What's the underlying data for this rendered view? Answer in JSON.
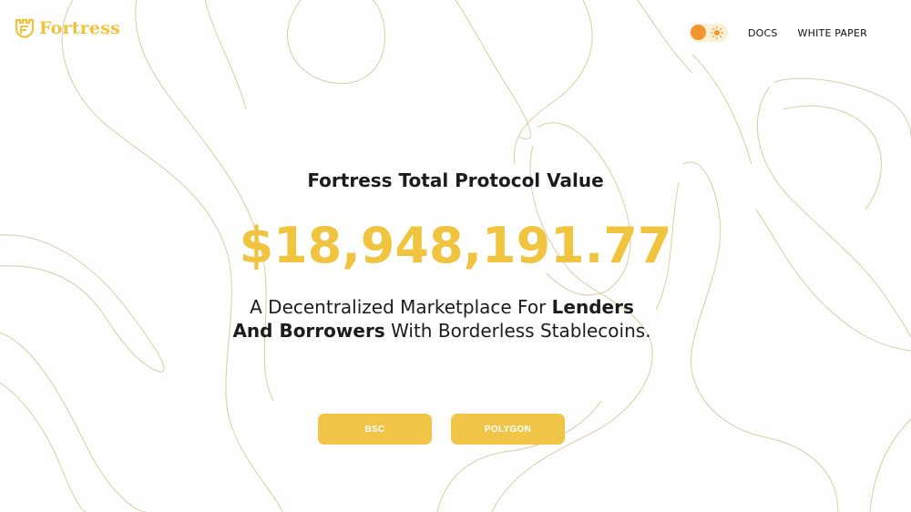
{
  "header": {
    "logo_text": "Fortress",
    "nav": {
      "theme_toggle": {
        "state": "light"
      },
      "docs_label": "DOCS",
      "whitepaper_label": "WHITE PAPER"
    }
  },
  "hero": {
    "title": "Fortress Total Protocol Value",
    "value": "$18,948,191.77",
    "tagline": {
      "part1": "A Decentralized Marketplace For ",
      "bold": "Lenders And Borrowers",
      "part2": " With Borderless Stablecoins."
    }
  },
  "actions": {
    "bsc_label": "BSC",
    "polygon_label": "POLYGON"
  },
  "colors": {
    "accent": "#f0c43f",
    "toggle_knob": "#f2952e",
    "contour": "#d9cca3",
    "text": "#1c1c1c"
  }
}
